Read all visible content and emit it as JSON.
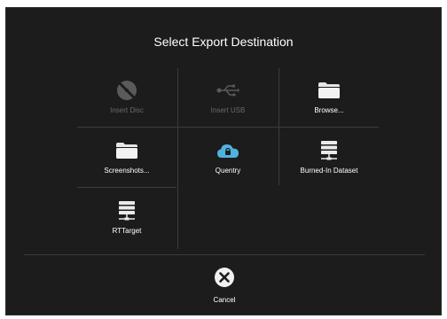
{
  "dialog": {
    "title": "Select Export Destination"
  },
  "destinations": [
    {
      "label": "Insert Disc",
      "icon": "disc-icon",
      "enabled": false
    },
    {
      "label": "Insert USB",
      "icon": "usb-icon",
      "enabled": false
    },
    {
      "label": "Browse...",
      "icon": "folder-icon",
      "enabled": true
    },
    {
      "label": "Screenshots...",
      "icon": "folder-icon",
      "enabled": true
    },
    {
      "label": "Quentry",
      "icon": "cloud-lock-icon",
      "enabled": true
    },
    {
      "label": "Burned-In Dataset",
      "icon": "server-icon",
      "enabled": true
    },
    {
      "label": "RTTarget",
      "icon": "server-icon",
      "enabled": true
    }
  ],
  "cancel": {
    "label": "Cancel",
    "icon": "close-circle-icon"
  },
  "colors": {
    "dialog_bg": "#1c1c1c",
    "text": "#ffffff",
    "disabled_text": "#6a6a6a",
    "divider": "#3c3c3c",
    "cloud_accent": "#4fb3e0"
  }
}
